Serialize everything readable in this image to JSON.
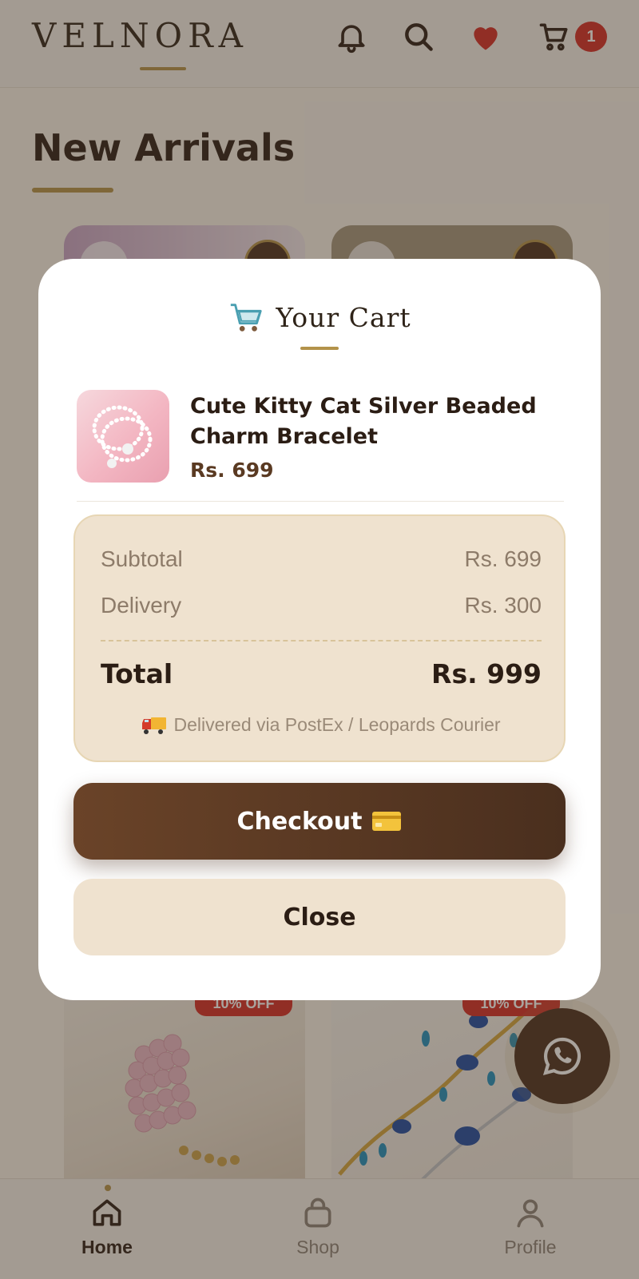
{
  "header": {
    "brand": "VELNORA",
    "cart_count": "1",
    "icons": [
      "bell-icon",
      "search-icon",
      "heart-icon",
      "cart-icon"
    ]
  },
  "section": {
    "title": "New Arrivals"
  },
  "products": [
    {
      "discount": "10% OFF"
    },
    {
      "discount": "10% OFF"
    }
  ],
  "modal": {
    "title": "Your Cart",
    "item": {
      "name": "Cute Kitty Cat Silver Beaded Charm Bracelet",
      "price": "Rs. 699"
    },
    "summary": {
      "subtotal_label": "Subtotal",
      "subtotal_value": "Rs. 699",
      "delivery_label": "Delivery",
      "delivery_value": "Rs. 300",
      "total_label": "Total",
      "total_value": "Rs. 999",
      "courier_note": "Delivered via PostEx / Leopards Courier"
    },
    "checkout_label": "Checkout",
    "close_label": "Close"
  },
  "bottom_nav": [
    {
      "label": "Home",
      "icon": "home-icon",
      "active": true
    },
    {
      "label": "Shop",
      "icon": "bag-icon",
      "active": false
    },
    {
      "label": "Profile",
      "icon": "user-icon",
      "active": false
    }
  ],
  "colors": {
    "accent_gold": "#b3924a",
    "brand_brown": "#4a2f1e",
    "badge_red": "#d42a26",
    "cream": "#efe2cf"
  }
}
